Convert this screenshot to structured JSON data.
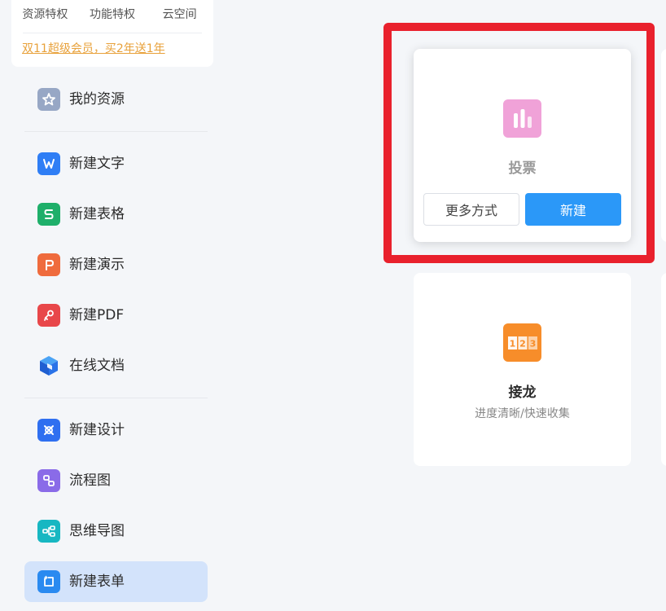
{
  "promo": {
    "tabs": [
      "资源特权",
      "功能特权",
      "云空间"
    ],
    "link": "双11超级会员，买2年送1年"
  },
  "sidebar": {
    "items": [
      {
        "label": "我的资源",
        "icon": "star-icon",
        "color": "#97a7c5"
      },
      {
        "label": "新建文字",
        "icon": "w-doc-icon",
        "color": "#2f7ef5"
      },
      {
        "label": "新建表格",
        "icon": "s-sheet-icon",
        "color": "#1eaf6a"
      },
      {
        "label": "新建演示",
        "icon": "p-slides-icon",
        "color": "#ef6b3d"
      },
      {
        "label": "新建PDF",
        "icon": "pdf-icon",
        "color": "#e8474a"
      },
      {
        "label": "在线文档",
        "icon": "cube-icon",
        "color": "#2a73e8"
      },
      {
        "label": "新建设计",
        "icon": "design-icon",
        "color": "#2f6ff0"
      },
      {
        "label": "流程图",
        "icon": "flowchart-icon",
        "color": "#8a6be8"
      },
      {
        "label": "思维导图",
        "icon": "mindmap-icon",
        "color": "#17b7c2"
      },
      {
        "label": "新建表单",
        "icon": "form-icon",
        "color": "#2a8af0"
      }
    ],
    "active_index": 9
  },
  "cards": {
    "vote": {
      "title": "投票",
      "icon": "bar-chart-icon",
      "icon_color": "#f0a2d8",
      "more_label": "更多方式",
      "new_label": "新建"
    },
    "relay": {
      "title": "接龙",
      "subtitle": "进度清晰/快速收集",
      "icon": "number-123-icon",
      "icon_color": "#f78d2a",
      "digits": [
        "1",
        "2",
        "3"
      ]
    }
  },
  "colors": {
    "highlight": "#e9212d",
    "primary": "#2b98f8",
    "promo_link": "#e8a13a",
    "active_bg": "#d3e3fb"
  }
}
